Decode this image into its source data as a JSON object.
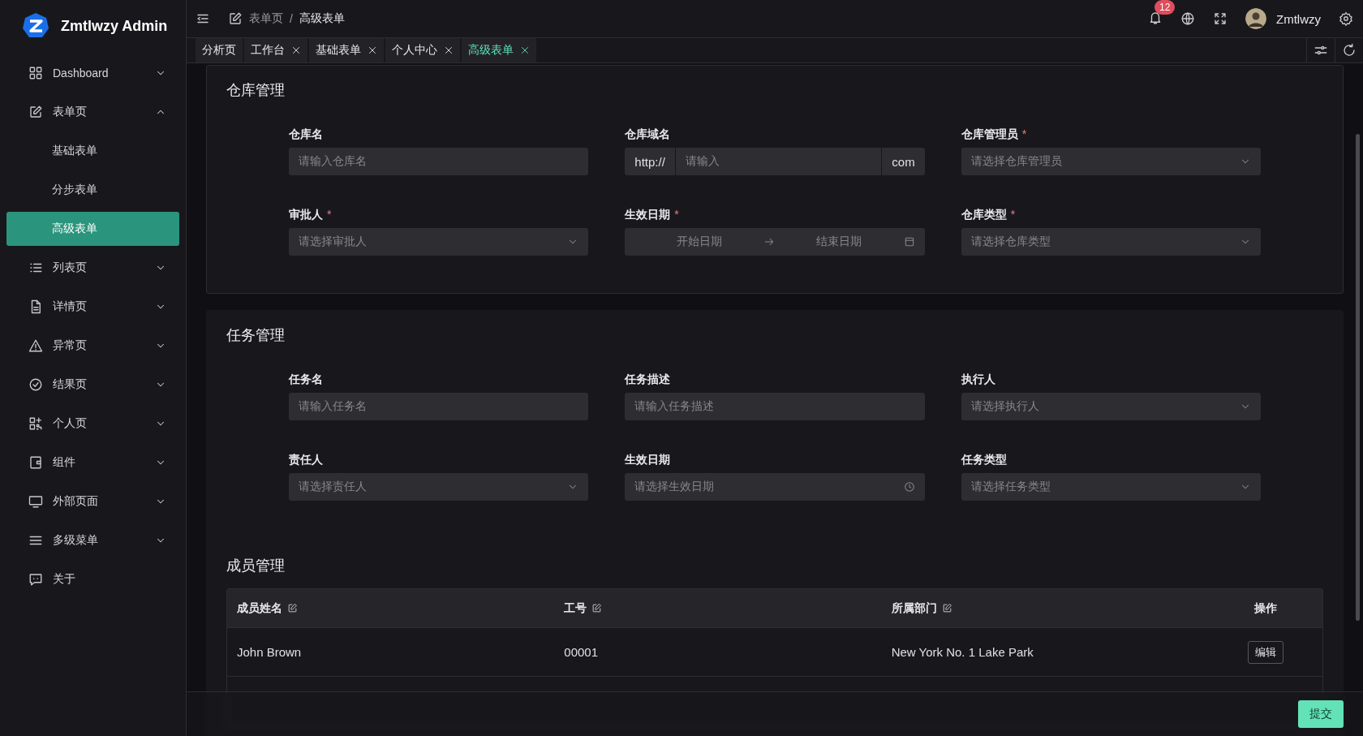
{
  "app": {
    "title": "Zmtlwzy Admin"
  },
  "sidebar": {
    "items": [
      {
        "label": "Dashboard",
        "kind": "group",
        "expanded": false
      },
      {
        "label": "表单页",
        "kind": "group",
        "expanded": true,
        "children": [
          {
            "label": "基础表单",
            "selected": false
          },
          {
            "label": "分步表单",
            "selected": false
          },
          {
            "label": "高级表单",
            "selected": true
          }
        ]
      },
      {
        "label": "列表页",
        "kind": "group",
        "expanded": false
      },
      {
        "label": "详情页",
        "kind": "group",
        "expanded": false
      },
      {
        "label": "异常页",
        "kind": "group",
        "expanded": false
      },
      {
        "label": "结果页",
        "kind": "group",
        "expanded": false
      },
      {
        "label": "个人页",
        "kind": "group",
        "expanded": false
      },
      {
        "label": "组件",
        "kind": "group",
        "expanded": false
      },
      {
        "label": "外部页面",
        "kind": "group",
        "expanded": false
      },
      {
        "label": "多级菜单",
        "kind": "group",
        "expanded": false
      },
      {
        "label": "关于",
        "kind": "leaf",
        "selected": false
      }
    ]
  },
  "header": {
    "breadcrumb": [
      {
        "label": "表单页"
      },
      {
        "label": "高级表单"
      }
    ],
    "breadcrumb_separator": "/",
    "notifications": "12",
    "user": "Zmtlwzy"
  },
  "tabs": [
    {
      "label": "分析页",
      "selected": false,
      "closable": false
    },
    {
      "label": "工作台",
      "selected": false,
      "closable": true
    },
    {
      "label": "基础表单",
      "selected": false,
      "closable": true
    },
    {
      "label": "个人中心",
      "selected": false,
      "closable": true
    },
    {
      "label": "高级表单",
      "selected": true,
      "closable": true
    }
  ],
  "sections": [
    {
      "title": "仓库管理",
      "fields": [
        {
          "label": "仓库名",
          "kind": "input",
          "placeholder": "请输入仓库名"
        },
        {
          "label": "仓库域名",
          "kind": "addon",
          "prefix": "http://",
          "placeholder": "请输入",
          "suffix": "com"
        },
        {
          "label": "仓库管理员",
          "required_mark": "*",
          "kind": "select",
          "placeholder": "请选择仓库管理员"
        },
        {
          "label": "审批人",
          "required_mark": "*",
          "kind": "select",
          "placeholder": "请选择审批人"
        },
        {
          "label": "生效日期",
          "required_mark": "*",
          "kind": "daterange",
          "start_placeholder": "开始日期",
          "end_placeholder": "结束日期"
        },
        {
          "label": "仓库类型",
          "required_mark": "*",
          "kind": "select",
          "placeholder": "请选择仓库类型"
        }
      ]
    },
    {
      "title": "任务管理",
      "fields": [
        {
          "label": "任务名",
          "kind": "input",
          "placeholder": "请输入任务名"
        },
        {
          "label": "任务描述",
          "kind": "input",
          "placeholder": "请输入任务描述"
        },
        {
          "label": "执行人",
          "kind": "select",
          "placeholder": "请选择执行人"
        },
        {
          "label": "责任人",
          "kind": "select",
          "placeholder": "请选择责任人"
        },
        {
          "label": "生效日期",
          "kind": "date",
          "placeholder": "请选择生效日期"
        },
        {
          "label": "任务类型",
          "kind": "select",
          "placeholder": "请选择任务类型"
        }
      ]
    }
  ],
  "members": {
    "title": "成员管理",
    "columns": [
      {
        "label": "成员姓名",
        "editable": true
      },
      {
        "label": "工号",
        "editable": true
      },
      {
        "label": "所属部门",
        "editable": true
      },
      {
        "label": "操作",
        "editable": false
      }
    ],
    "rows": [
      {
        "cells": [
          "John Brown",
          "00001",
          "New York No. 1 Lake Park"
        ],
        "action": "编辑"
      }
    ]
  },
  "footer": {
    "submit": "提交"
  }
}
